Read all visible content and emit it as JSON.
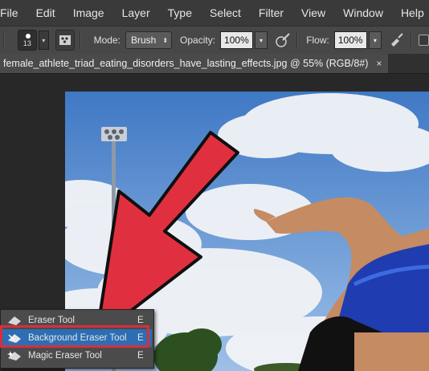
{
  "menu": [
    "File",
    "Edit",
    "Image",
    "Layer",
    "Type",
    "Select",
    "Filter",
    "View",
    "Window",
    "Help"
  ],
  "options": {
    "brush_size": "13",
    "mode_label": "Mode:",
    "mode_value": "Brush",
    "opacity_label": "Opacity:",
    "opacity_value": "100%",
    "flow_label": "Flow:",
    "flow_value": "100%"
  },
  "document": {
    "tab_title": "female_athlete_triad_eating_disorders_have_lasting_effects.jpg @ 55% (RGB/8#)",
    "close_glyph": "×"
  },
  "tool_flyout": {
    "items": [
      {
        "label": "Eraser Tool",
        "shortcut": "E"
      },
      {
        "label": "Background Eraser Tool",
        "shortcut": "E",
        "selected": true
      },
      {
        "label": "Magic Eraser Tool",
        "shortcut": "E"
      }
    ]
  },
  "colors": {
    "highlight": "#d62f3d",
    "selection": "#2d6db3",
    "arrow": "#e03040"
  }
}
